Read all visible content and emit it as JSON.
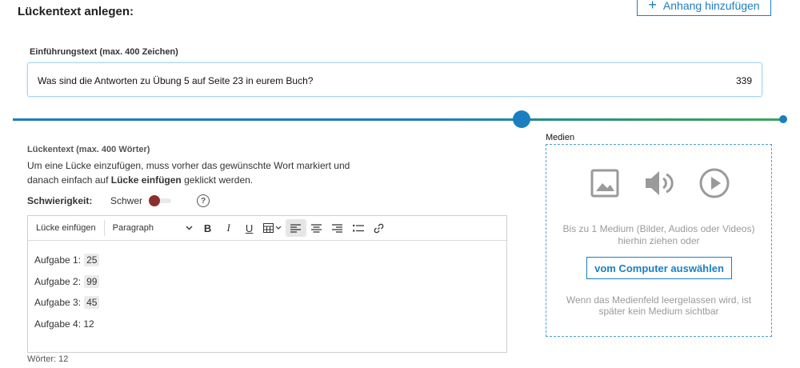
{
  "page": {
    "title": "Lückentext anlegen:"
  },
  "attach_button": {
    "plus": "+",
    "label": "Anhang hinzufügen"
  },
  "intro": {
    "label": "Einführungstext (max. 400 Zeichen)",
    "value": "Was sind die Antworten zu Übung 5 auf Seite 23 in eurem Buch?",
    "remaining": "339"
  },
  "slider": {
    "value_fraction": 0.65
  },
  "cloze": {
    "label": "Lückentext (max. 400 Wörter)",
    "help_part1": "Um eine Lücke einzufügen, muss vorher das gewünschte Wort markiert und danach einfach auf ",
    "help_bold": "Lücke einfügen",
    "help_part2": " geklickt werden.",
    "difficulty_label": "Schwierigkeit:",
    "difficulty_value": "Schwer",
    "help_icon": "?"
  },
  "toolbar": {
    "insert_gap": "Lücke einfügen",
    "format": "Paragraph",
    "bold": "B",
    "italic": "I",
    "underline": "U"
  },
  "content": {
    "lines": [
      {
        "prefix": "Aufgabe 1:",
        "gap": "25"
      },
      {
        "prefix": "Aufgabe 2:",
        "gap": "99"
      },
      {
        "prefix": "Aufgabe 3:",
        "gap": "45"
      },
      {
        "prefix": "Aufgabe 4: 12",
        "gap": ""
      }
    ]
  },
  "word_count": "Wörter: 12",
  "media": {
    "label": "Medien",
    "drop_hint": "Bis zu 1 Medium (Bilder, Audios oder Videos) hierhin ziehen oder",
    "choose_button": "vom Computer auswählen",
    "empty_hint": "Wenn das Medienfeld leergelassen wird, ist später kein Medium sichtbar",
    "icons": [
      "image-icon",
      "speaker-icon",
      "play-icon"
    ]
  }
}
